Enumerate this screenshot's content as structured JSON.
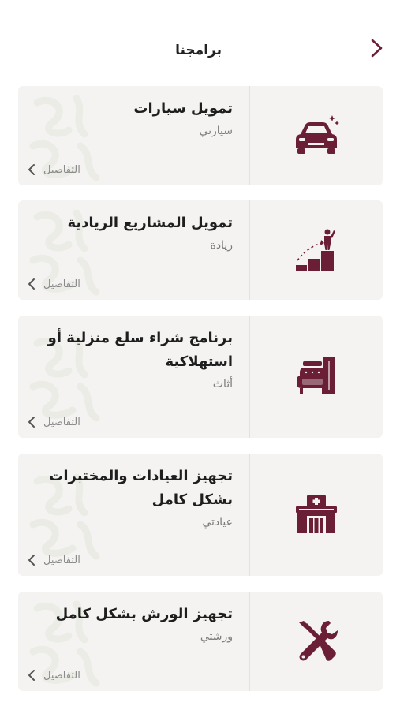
{
  "header": {
    "title": "برامجنا",
    "back_icon": "chevron-right-icon"
  },
  "colors": {
    "brand": "#6b1f37",
    "card_bg": "#f4f3f1",
    "watermark": "#e3e5dc"
  },
  "programs": [
    {
      "title": "تمويل سيارات",
      "subtitle": "سيارتي",
      "details_label": "التفاصيل",
      "icon": "car-icon"
    },
    {
      "title": "تمويل المشاريع الريادية",
      "subtitle": "ريادة",
      "details_label": "التفاصيل",
      "icon": "growth-steps-icon"
    },
    {
      "title": "برنامج شراء سلع منزلية أو استهلاكية",
      "subtitle": "أثاث",
      "details_label": "التفاصيل",
      "icon": "furniture-icon"
    },
    {
      "title": "تجهيز العيادات والمختبرات بشكل كامل",
      "subtitle": "عيادتي",
      "details_label": "التفاصيل",
      "icon": "clinic-icon"
    },
    {
      "title": "تجهيز الورش بشكل كامل",
      "subtitle": "ورشتي",
      "details_label": "التفاصيل",
      "icon": "tools-icon"
    }
  ]
}
